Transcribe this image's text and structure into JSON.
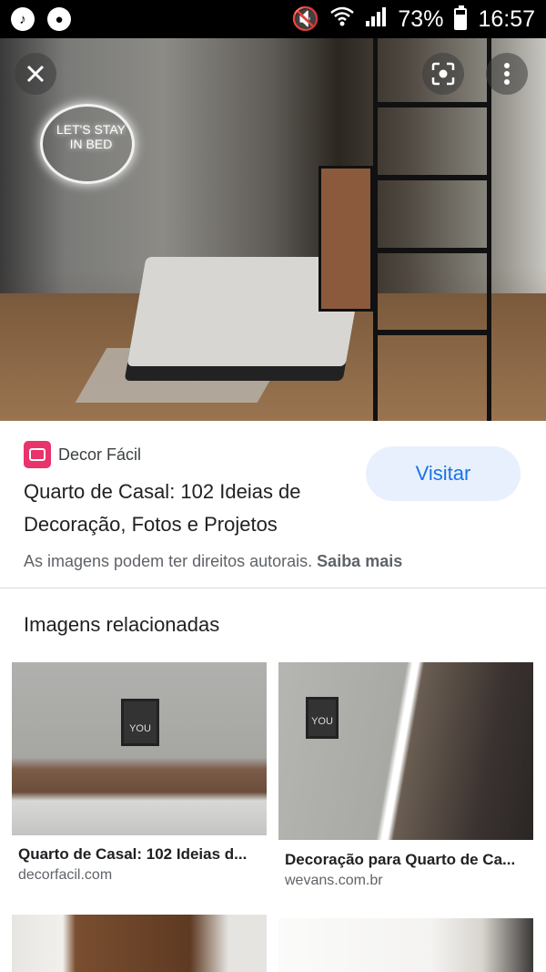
{
  "status_bar": {
    "battery": "73%",
    "battery_level": 0.73,
    "time": "16:57",
    "icons": [
      "music-note-icon",
      "notification-icon",
      "mute-icon",
      "wifi-icon",
      "signal-icon",
      "battery-icon"
    ]
  },
  "hero": {
    "image_name": "hero-bedroom-image",
    "neon_sign_text": "LET'S STAY IN BED"
  },
  "result": {
    "site_name": "Decor Fácil",
    "title": "Quarto de Casal: 102 Ideias de Decoração, Fotos e Projetos",
    "visit_label": "Visitar",
    "copyright_text": "As imagens podem ter direitos autorais.",
    "learn_more_label": "Saiba mais"
  },
  "related": {
    "heading": "Imagens relacionadas",
    "items": [
      {
        "caption": "Quarto de Casal: 102 Ideias d...",
        "domain": "decorfacil.com",
        "poster_text": "YOU"
      },
      {
        "caption": "Decoração para Quarto de Ca...",
        "domain": "wevans.com.br",
        "poster_text": "YOU"
      },
      {
        "caption": "",
        "domain": ""
      },
      {
        "caption": "",
        "domain": ""
      }
    ]
  },
  "colors": {
    "accent": "#1a73e8",
    "visit_bg": "#e8f0fe",
    "logo_bg": "#e8336b",
    "status_bg": "#000000"
  }
}
